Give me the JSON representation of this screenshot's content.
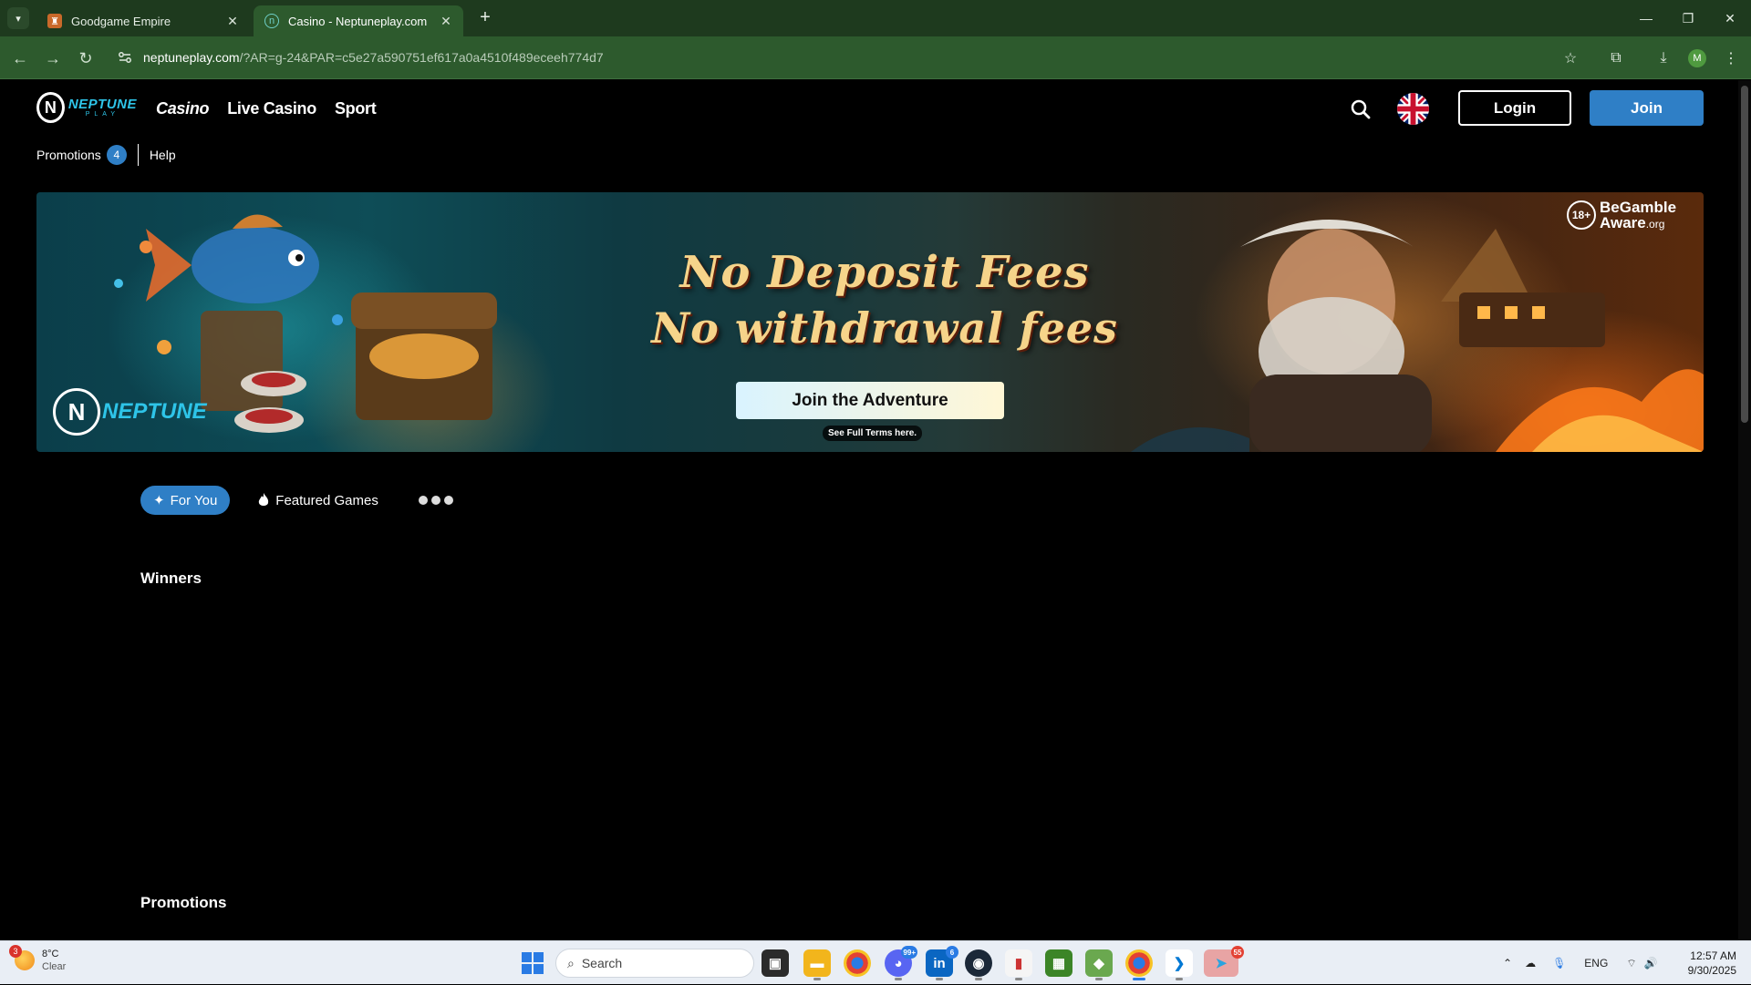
{
  "browser": {
    "tabs": [
      {
        "title": "Goodgame Empire",
        "active": false
      },
      {
        "title": "Casino - Neptuneplay.com",
        "active": true
      }
    ],
    "url_host": "neptuneplay.com",
    "url_rest": "/?AR=g-24&PAR=c5e27a590751ef617a0a4510f489eceeh774d7",
    "profile_initial": "M"
  },
  "header": {
    "logo_word": "NEPTUNE",
    "logo_sub": "PLAY",
    "nav": [
      {
        "label": "Casino"
      },
      {
        "label": "Live Casino"
      },
      {
        "label": "Sport"
      }
    ],
    "login_label": "Login",
    "join_label": "Join"
  },
  "subnav": {
    "promotions_label": "Promotions",
    "promotions_count": "4",
    "help_label": "Help"
  },
  "banner": {
    "headline_1": "No Deposit Fees",
    "headline_2": "No withdrawal fees",
    "cta_label": "Join the Adventure",
    "terms_label": "See Full Terms here.",
    "age_label": "18+",
    "gamble_aware_1": "BeGamble",
    "gamble_aware_2": "Aware",
    "gamble_aware_suffix": ".org",
    "logo_word": "NEPTUNE"
  },
  "categories": {
    "for_you_label": "For You",
    "featured_label": "Featured Games"
  },
  "sections": {
    "winners_title": "Winners",
    "promotions_title": "Promotions"
  },
  "taskbar": {
    "weather_temp": "8°C",
    "weather_desc": "Clear",
    "weather_badge": "3",
    "search_placeholder": "Search",
    "discord_badge": "99+",
    "linkedin_badge": "6",
    "telegram_badge": "55",
    "language": "ENG",
    "time": "12:57 AM",
    "date": "9/30/2025"
  },
  "colors": {
    "accent_blue": "#2f7fc6",
    "browser_green": "#2d5a2d",
    "headline_gold": "#f6d48a"
  }
}
